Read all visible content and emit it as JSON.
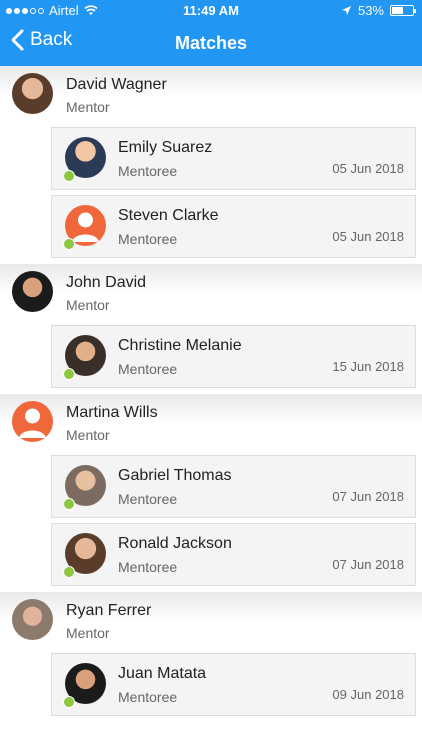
{
  "status_bar": {
    "carrier": "Airtel",
    "time": "11:49 AM",
    "battery": "53%",
    "battery_fraction": 0.53,
    "icons": [
      "wifi-icon",
      "location-arrow-icon",
      "battery-icon"
    ]
  },
  "nav": {
    "back_label": "Back",
    "title": "Matches"
  },
  "groups": [
    {
      "mentor": {
        "name": "David Wagner",
        "role": "Mentor"
      },
      "mentees": [
        {
          "name": "Emily Suarez",
          "role": "Mentoree",
          "date": "05 Jun 2018"
        },
        {
          "name": "Steven Clarke",
          "role": "Mentoree",
          "date": "05 Jun 2018"
        }
      ]
    },
    {
      "mentor": {
        "name": "John David",
        "role": "Mentor"
      },
      "mentees": [
        {
          "name": "Christine Melanie",
          "role": "Mentoree",
          "date": "15 Jun 2018"
        }
      ]
    },
    {
      "mentor": {
        "name": "Martina Wills",
        "role": "Mentor"
      },
      "mentees": [
        {
          "name": "Gabriel Thomas",
          "role": "Mentoree",
          "date": "07 Jun 2018"
        },
        {
          "name": "Ronald Jackson",
          "role": "Mentoree",
          "date": "07 Jun 2018"
        }
      ]
    },
    {
      "mentor": {
        "name": "Ryan Ferrer",
        "role": "Mentor"
      },
      "mentees": [
        {
          "name": "Juan Matata",
          "role": "Mentoree",
          "date": "09 Jun 2018"
        }
      ]
    }
  ],
  "colors": {
    "header": "#2196f3",
    "online_dot": "#8dc63f",
    "placeholder_avatar": "#f0673b"
  }
}
